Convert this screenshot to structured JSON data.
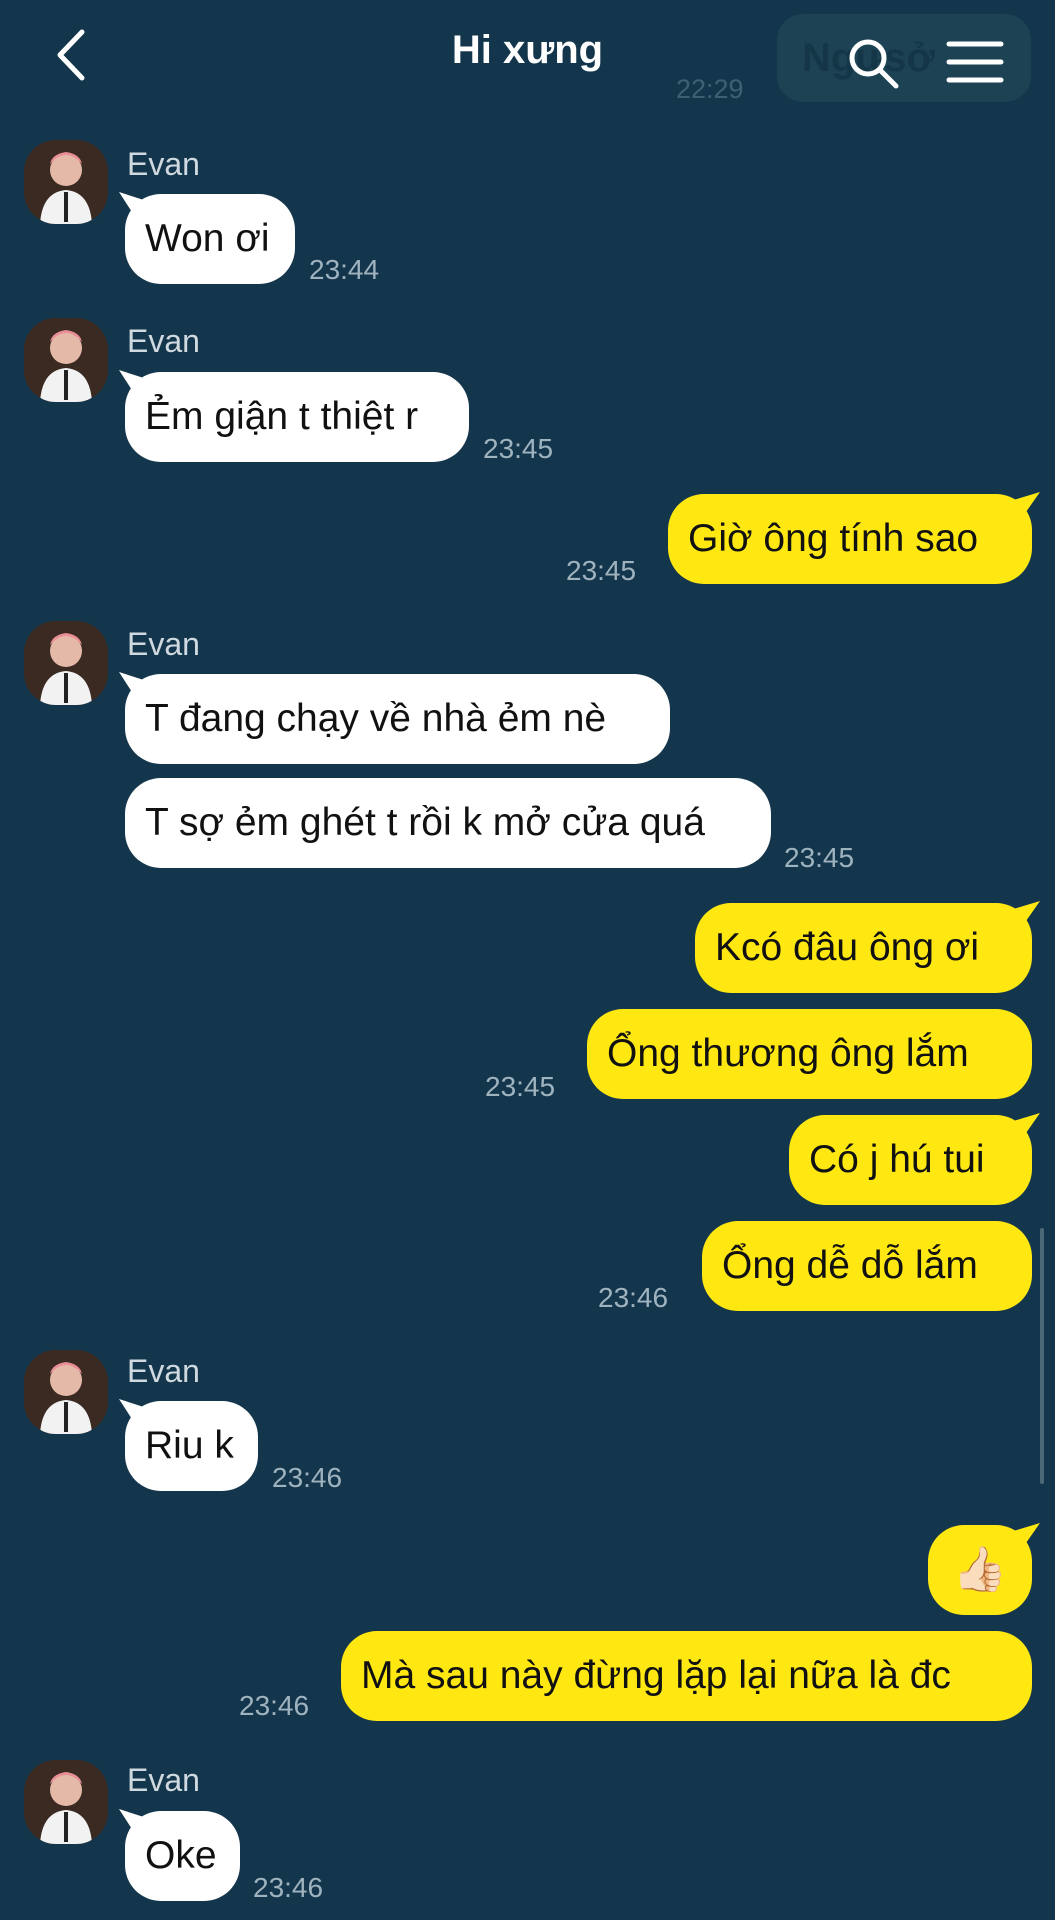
{
  "header": {
    "title": "Hi xưng",
    "ghost_chip_text": "Ngưsở",
    "ghost_time": "22:29"
  },
  "icons": {
    "back": "chevron-left-icon",
    "search": "search-icon",
    "menu": "hamburger-menu-icon"
  },
  "colors": {
    "background": "#14364c",
    "incoming_bubble": "#ffffff",
    "outgoing_bubble": "#ffe812"
  },
  "messages": [
    {
      "sender": "Evan",
      "text": "Won ơi",
      "time": "23:44"
    },
    {
      "sender": "Evan",
      "text": "Ẻm giận t thiệt r",
      "time": "23:45"
    },
    {
      "sender": "me",
      "text": "Giờ ông tính sao",
      "time": "23:45"
    },
    {
      "sender": "Evan",
      "texts": [
        "T đang chạy về nhà ẻm nè",
        "T sợ ẻm ghét t rồi k mở cửa quá"
      ],
      "time": "23:45"
    },
    {
      "sender": "me",
      "texts": [
        "Kcó đâu ông ơi",
        "Ổng thương ông lắm"
      ],
      "time": "23:45"
    },
    {
      "sender": "me",
      "texts": [
        "Có j hú tui",
        "Ổng dễ dỗ lắm"
      ],
      "time": "23:46"
    },
    {
      "sender": "Evan",
      "text": "Riu k",
      "time": "23:46"
    },
    {
      "sender": "me",
      "texts": [
        "👍🏻",
        "Mà sau này đừng lặp lại nữa là đc"
      ],
      "time": "23:46"
    },
    {
      "sender": "Evan",
      "text": "Oke",
      "time": "23:46"
    }
  ]
}
